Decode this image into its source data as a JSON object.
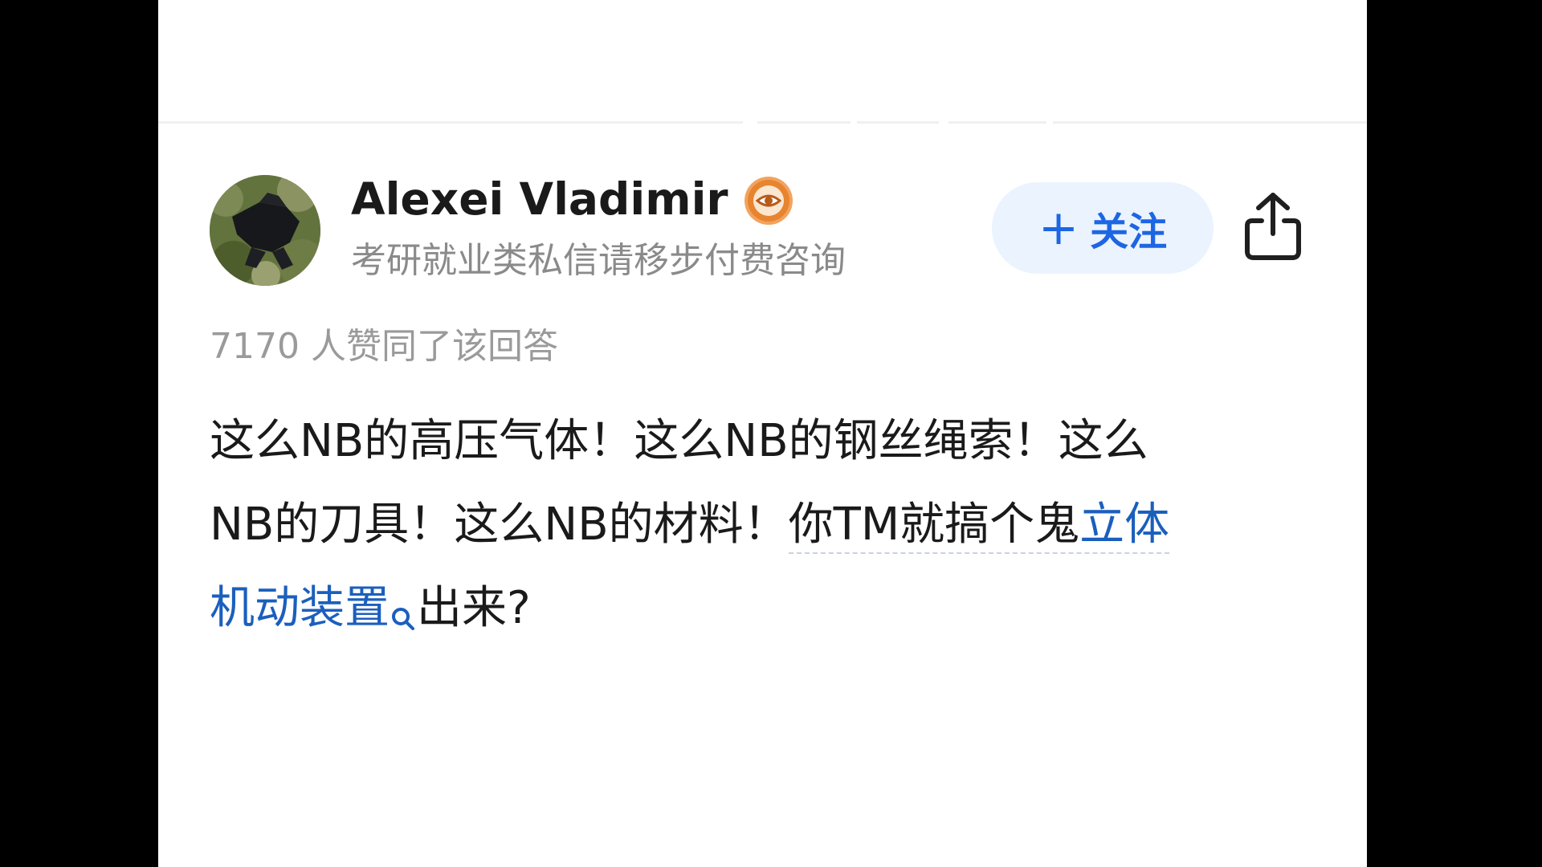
{
  "author": {
    "name": "Alexei Vladimir",
    "bio": "考研就业类私信请移步付费咨询",
    "badge_icon": "eye-badge-icon"
  },
  "actions": {
    "follow_plus": "+",
    "follow_label": "关注",
    "share_icon": "share-icon"
  },
  "votes": {
    "text": "7170 人赞同了该回答"
  },
  "answer": {
    "line1": "这么NB的高压气体！这么NB的钢丝绳索！这么",
    "line2_a": "NB的刀具！这么NB的材料！",
    "line2_b": "你TM就搞个鬼",
    "line2_link": "立体",
    "line3_link": "机动装置",
    "line3_rest": "出来?"
  },
  "colors": {
    "link": "#1b5fbd",
    "follow_bg": "#ebf3fe",
    "follow_text": "#1d66e3",
    "badge": "#e88a3c"
  }
}
